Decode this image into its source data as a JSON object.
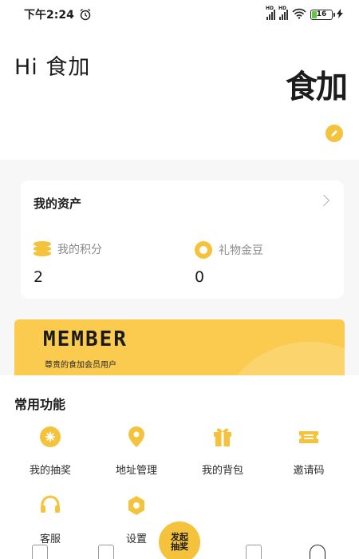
{
  "status": {
    "time": "下午2:24",
    "battery": "16"
  },
  "header": {
    "greeting": "Hi 食加",
    "logo_text": "食加"
  },
  "assets": {
    "title": "我的资产",
    "points": {
      "label": "我的积分",
      "value": "2"
    },
    "beans": {
      "label": "礼物金豆",
      "value": "0"
    }
  },
  "member": {
    "title": "MEMBER",
    "subtitle": "尊贵的食加会员用户"
  },
  "functions": {
    "title": "常用功能",
    "items": [
      {
        "label": "我的抽奖",
        "icon": "lottery-icon"
      },
      {
        "label": "地址管理",
        "icon": "location-pin-icon"
      },
      {
        "label": "我的背包",
        "icon": "gift-box-icon"
      },
      {
        "label": "邀请码",
        "icon": "ticket-icon"
      },
      {
        "label": "客服",
        "icon": "headset-icon"
      },
      {
        "label": "设置",
        "icon": "settings-icon"
      }
    ]
  },
  "tabbar": {
    "center_label": "发起抽奖"
  },
  "colors": {
    "accent": "#f5c23b",
    "member_bg": "#fbcb4f"
  }
}
